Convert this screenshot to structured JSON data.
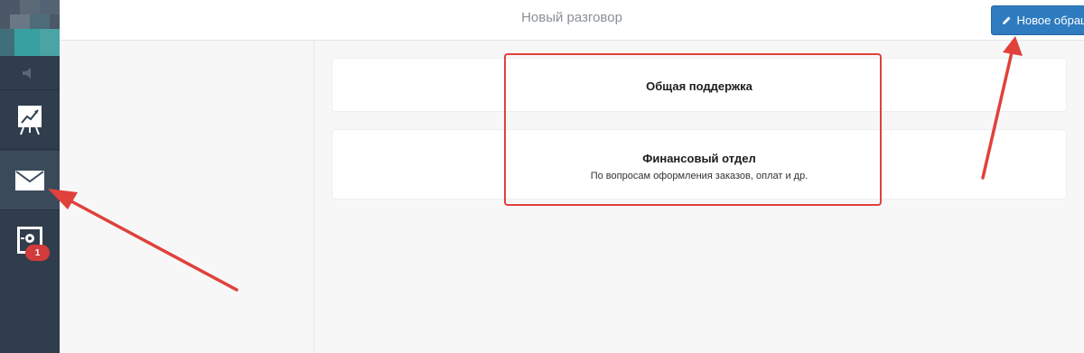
{
  "topbar": {
    "title": "Новый разговор",
    "new_button_label": "Новое обращение",
    "new_button_icon": "pencil-icon"
  },
  "sidebar": {
    "items": [
      {
        "name": "stats",
        "icon": "chart-board-icon"
      },
      {
        "name": "messages",
        "icon": "envelope-icon",
        "active": true
      },
      {
        "name": "tickets",
        "icon": "settings-screen-icon",
        "badge": "1"
      }
    ]
  },
  "main": {
    "departments": [
      {
        "title": "Общая поддержка"
      },
      {
        "title": "Финансовый отдел",
        "subtitle": "По вопросам оформления заказов, оплат и др."
      }
    ]
  },
  "colors": {
    "sidebar_bg": "#2f3d4d",
    "accent_button": "#2e7bc0",
    "annotation_red": "#e0413b",
    "badge_red": "#d23b3b"
  }
}
